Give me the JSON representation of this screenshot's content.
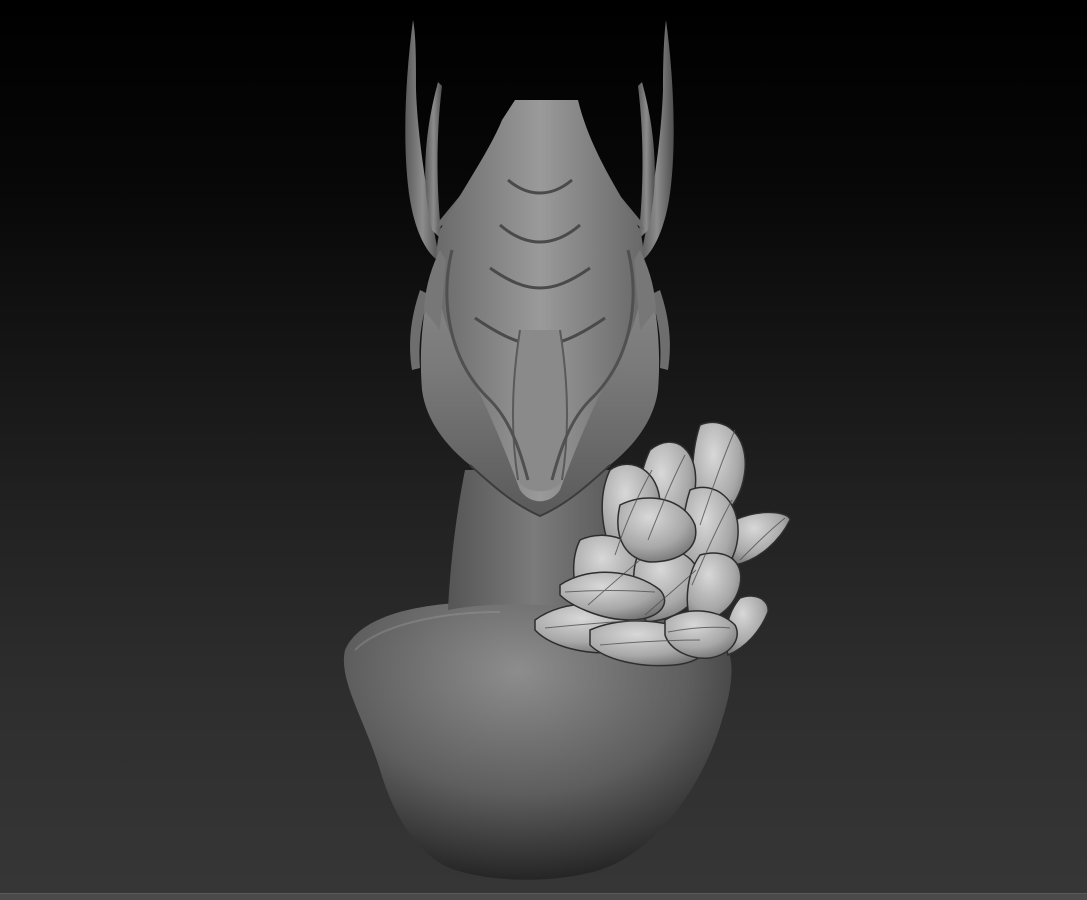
{
  "viewport": {
    "background_top": "#000000",
    "background_bottom": "#363636",
    "mesh_color": "#8a8a8a"
  },
  "model": {
    "parts": [
      "dragon-head",
      "antlers",
      "neck",
      "bust-base",
      "feather-cluster"
    ]
  },
  "bottom_bar": {
    "color": "#4a4a4a"
  }
}
